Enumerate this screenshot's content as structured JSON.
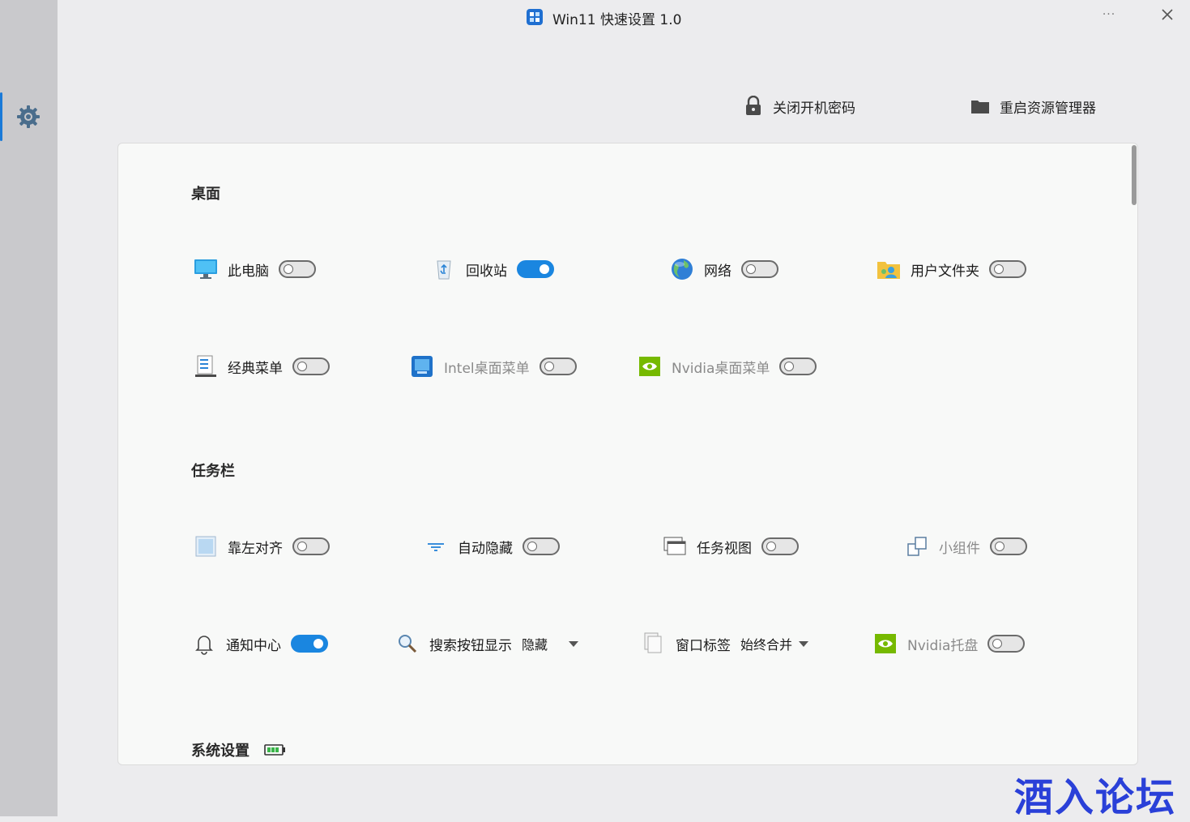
{
  "window": {
    "title": "Win11 快速设置 1.0",
    "more_label": "···"
  },
  "sidebar": {
    "items": [
      {
        "icon": "gear-icon",
        "selected": true
      }
    ]
  },
  "actions": {
    "disable_password": "关闭开机密码",
    "restart_explorer": "重启资源管理器"
  },
  "sections": {
    "desktop": {
      "title": "桌面",
      "items": [
        {
          "label": "此电脑",
          "state": "off"
        },
        {
          "label": "回收站",
          "state": "on"
        },
        {
          "label": "网络",
          "state": "off"
        },
        {
          "label": "用户文件夹",
          "state": "off"
        },
        {
          "label": "经典菜单",
          "state": "off"
        },
        {
          "label": "Intel桌面菜单",
          "state": "off",
          "dimmed": true
        },
        {
          "label": "Nvidia桌面菜单",
          "state": "off",
          "dimmed": true
        }
      ]
    },
    "taskbar": {
      "title": "任务栏",
      "items": [
        {
          "label": "靠左对齐",
          "state": "off"
        },
        {
          "label": "自动隐藏",
          "state": "off"
        },
        {
          "label": "任务视图",
          "state": "off"
        },
        {
          "label": "小组件",
          "state": "off",
          "dimmed": true
        },
        {
          "label": "通知中心",
          "state": "on"
        },
        {
          "label": "搜索按钮显示",
          "value": "隐藏"
        },
        {
          "label": "窗口标签",
          "value": "始终合并"
        },
        {
          "label": "Nvidia托盘",
          "state": "off",
          "dimmed": true
        }
      ]
    },
    "system": {
      "title": "系统设置"
    }
  },
  "watermark": "酒入论坛",
  "colors": {
    "accent": "#1a86e0",
    "sidebar": "#c9c9cc",
    "panel": "#f8f9f8"
  }
}
